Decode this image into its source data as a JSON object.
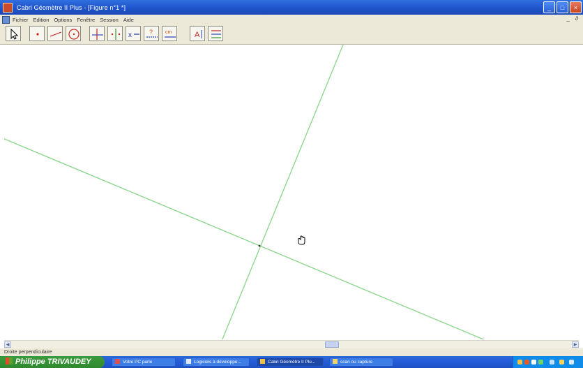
{
  "window": {
    "title": "Cabri Géomètre II Plus - [Figure n°1 *]",
    "controls": [
      "minimize",
      "maximize",
      "close"
    ]
  },
  "menu": {
    "items": [
      "Fichier",
      "Edition",
      "Options",
      "Fenêtre",
      "Session",
      "Aide"
    ],
    "mdi_controls": "_ ∂"
  },
  "toolbar": {
    "tools": [
      {
        "name": "pointer-tool",
        "icon": "arrow-pointer-icon"
      },
      {
        "name": "point-tool",
        "icon": "point-icon"
      },
      {
        "name": "line-tool",
        "icon": "line-icon"
      },
      {
        "name": "circle-tool",
        "icon": "circle-icon"
      },
      {
        "name": "perpendicular-line-tool",
        "icon": "perpendicular-icon"
      },
      {
        "name": "transformation-tool",
        "icon": "reflection-icon"
      },
      {
        "name": "macro-tool",
        "icon": "macro-icon"
      },
      {
        "name": "check-property-tool",
        "icon": "question-icon"
      },
      {
        "name": "measure-tool",
        "icon": "measure-icon"
      },
      {
        "name": "display-tool",
        "icon": "text-label-icon"
      },
      {
        "name": "attributes-tool",
        "icon": "attributes-icon"
      }
    ]
  },
  "canvas": {
    "line_color": "#8fd68f",
    "cursor": "hand-cursor"
  },
  "status": {
    "text": "Droite perpendiculaire"
  },
  "taskbar": {
    "start_label": "Philippe TRIVAUDEY",
    "tasks": [
      {
        "label": "Votre PC parle",
        "active": false
      },
      {
        "label": "Logiciels à développe...",
        "active": false
      },
      {
        "label": "Cabri Géomètre II Plu...",
        "active": true
      },
      {
        "label": "scan ou capture",
        "active": false
      }
    ]
  }
}
